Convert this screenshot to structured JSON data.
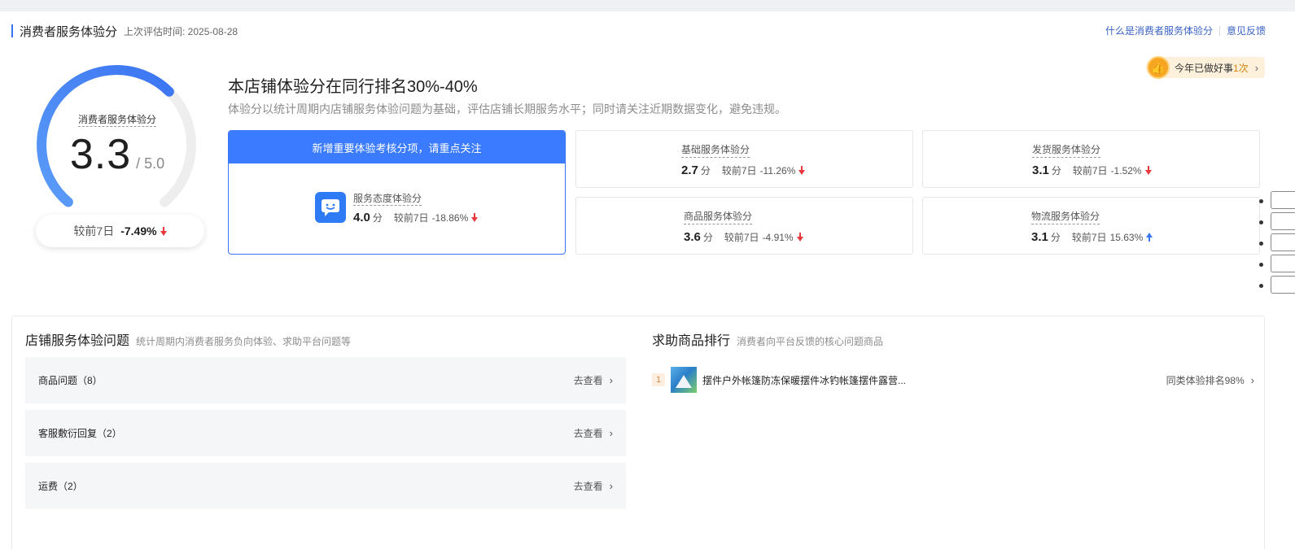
{
  "header": {
    "title": "消费者服务体验分",
    "last_eval": "上次评估时间: 2025-08-28",
    "link_what": "什么是消费者服务体验分",
    "link_feedback": "意见反馈"
  },
  "gauge": {
    "label": "消费者服务体验分",
    "score": "3.3",
    "max": "/ 5.0",
    "score_value": 3.3,
    "max_value": 5.0,
    "compare_label": "较前7日",
    "compare_value": "-7.49%"
  },
  "summary": {
    "rank_text": "本店铺体验分在同行排名30%-40%",
    "description": "体验分以统计周期内店铺服务体验问题为基础，评估店铺长期服务水平；同时请关注近期数据变化，避免违规。"
  },
  "good_deeds": {
    "label": "今年已做好事",
    "count": "1次"
  },
  "focus_card": {
    "header": "新增重要体验考核分项，请重点关注",
    "name": "服务态度体验分",
    "score": "4.0",
    "unit": "分",
    "compare_label": "较前7日",
    "compare_value": "-18.86%"
  },
  "sub_scores": [
    {
      "name": "基础服务体验分",
      "score": "2.7",
      "unit": "分",
      "compare_label": "较前7日",
      "compare_value": "-11.26%",
      "trend": "down"
    },
    {
      "name": "发货服务体验分",
      "score": "3.1",
      "unit": "分",
      "compare_label": "较前7日",
      "compare_value": "-1.52%",
      "trend": "down"
    },
    {
      "name": "商品服务体验分",
      "score": "3.6",
      "unit": "分",
      "compare_label": "较前7日",
      "compare_value": "-4.91%",
      "trend": "down"
    },
    {
      "name": "物流服务体验分",
      "score": "3.1",
      "unit": "分",
      "compare_label": "较前7日",
      "compare_value": "15.63%",
      "trend": "up"
    }
  ],
  "issues_panel": {
    "title": "店铺服务体验问题",
    "subtitle": "统计周期内消费者服务负向体验、求助平台问题等",
    "items": [
      {
        "label": "商品问题（8）",
        "action": "去查看"
      },
      {
        "label": "客服敷衍回复（2）",
        "action": "去查看"
      },
      {
        "label": "运费（2）",
        "action": "去查看"
      }
    ]
  },
  "products_panel": {
    "title": "求助商品排行",
    "subtitle": "消费者向平台反馈的核心问题商品",
    "items": [
      {
        "rank": "1",
        "name": "摆件户外帐篷防冻保暖摆件冰钓帐篷摆件露营...",
        "rank_text": "同类体验排名98%"
      }
    ]
  },
  "colors": {
    "accent": "#3b74f2",
    "focus_header": "#3b7bff",
    "down": "#e8383d",
    "up": "#3b74f2",
    "issue_bg": "#f5f6f8",
    "badge_bg": "#fdf1dc"
  },
  "icons": {
    "gauge": "gauge-arc",
    "focus": "chat-smile-icon",
    "good_deeds": "thumbs-up-medal-icon",
    "chevron": "chevron-right-icon"
  }
}
